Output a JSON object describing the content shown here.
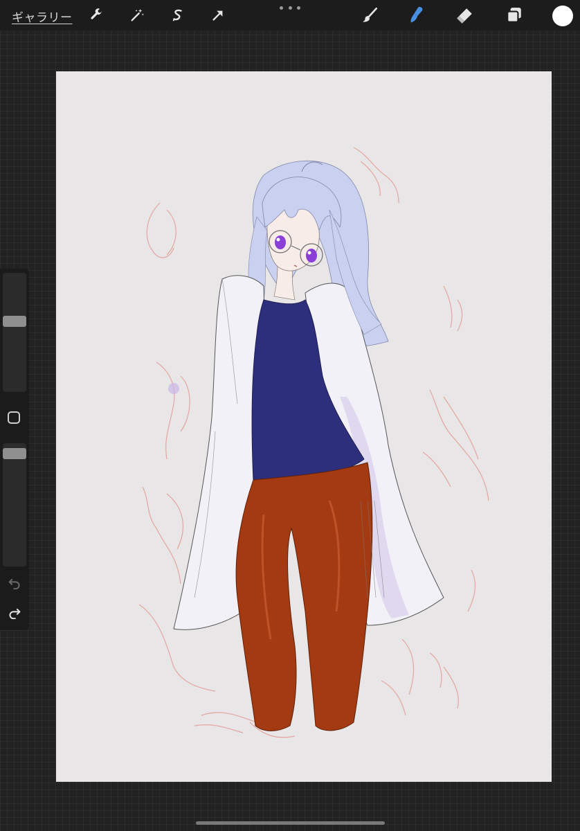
{
  "topbar": {
    "gallery_label": "ギャラリー",
    "tools_left": [
      "wrench-icon",
      "magic-wand-icon",
      "selection-s-icon",
      "transform-arrow-icon"
    ],
    "tools_right": [
      "brush-icon",
      "smudge-icon",
      "eraser-icon",
      "layers-icon"
    ],
    "active_tool": "smudge-icon",
    "accent_color": "#4a90e2",
    "current_color": "#ffffff"
  },
  "sidebar": {
    "brush_size_level": 0.4,
    "opacity_level": 0.1,
    "modifier": "modify-button",
    "undo": "undo-icon",
    "redo": "redo-icon"
  },
  "canvas": {
    "background": "#e8e6e7",
    "artwork": "anime-girl-lab-coat-drawing",
    "colors": {
      "hair": "#c9d0f0",
      "shirt": "#2e2f7c",
      "pants": "#a43a12",
      "coat": "#f3f1f8",
      "eyes": "#8a3fd6",
      "sketch": "#e39a92"
    }
  }
}
